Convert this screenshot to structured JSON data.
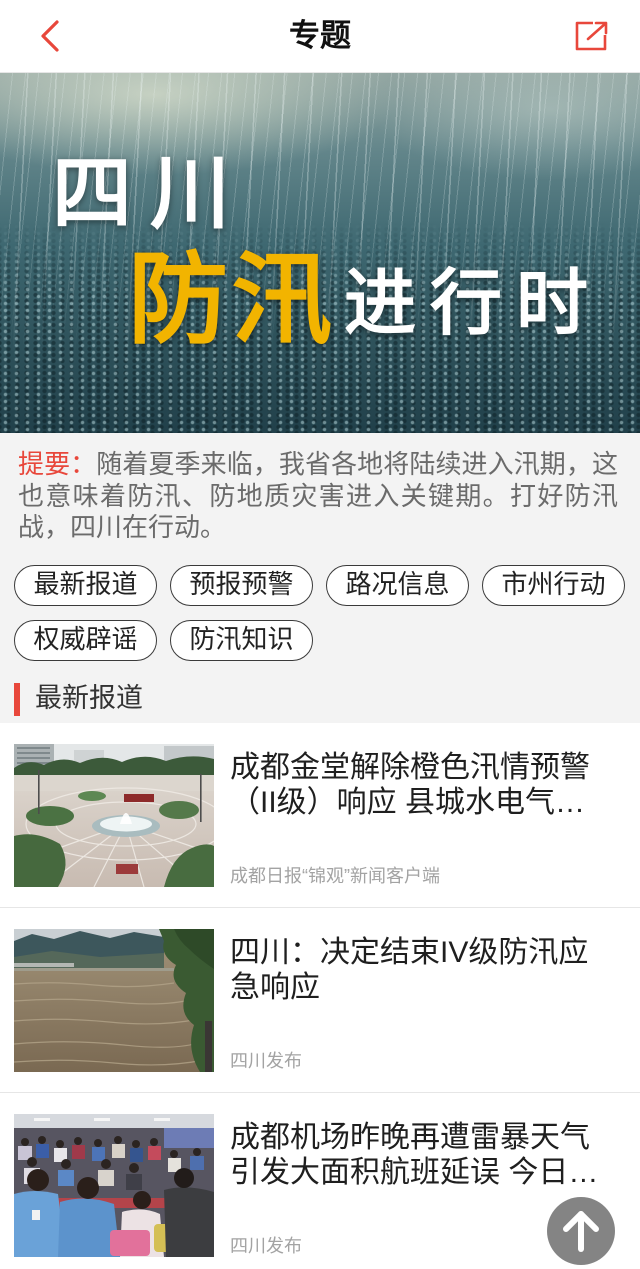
{
  "theme": {
    "accent": "#e8473b",
    "highlight": "#f2b400",
    "panel": "#f3f3f3"
  },
  "header": {
    "title": "专题",
    "back_icon": "chevron-left-icon",
    "share_icon": "share-external-icon"
  },
  "banner": {
    "line1": "四川",
    "highlight": "防汛",
    "rest": "进行时"
  },
  "summary": {
    "label": "提要：",
    "text": "随着夏季来临，我省各地将陆续进入汛期，这也意味着防汛、防地质灾害进入关键期。打好防汛战，四川在行动。"
  },
  "tags": [
    "最新报道",
    "预报预警",
    "路况信息",
    "市州行动",
    "权威辟谣",
    "防汛知识"
  ],
  "section": {
    "title": "最新报道"
  },
  "articles": [
    {
      "title": "成都金堂解除橙色汛情预警（II级）响应 县城水电气…",
      "source": "成都日报“锦观”新闻客户端"
    },
    {
      "title": "四川：决定结束IV级防汛应急响应",
      "source": "四川发布"
    },
    {
      "title": "成都机场昨晚再遭雷暴天气引发大面积航班延误 今日…",
      "source": "四川发布"
    }
  ],
  "scroll_top": {
    "icon": "arrow-up-icon"
  }
}
